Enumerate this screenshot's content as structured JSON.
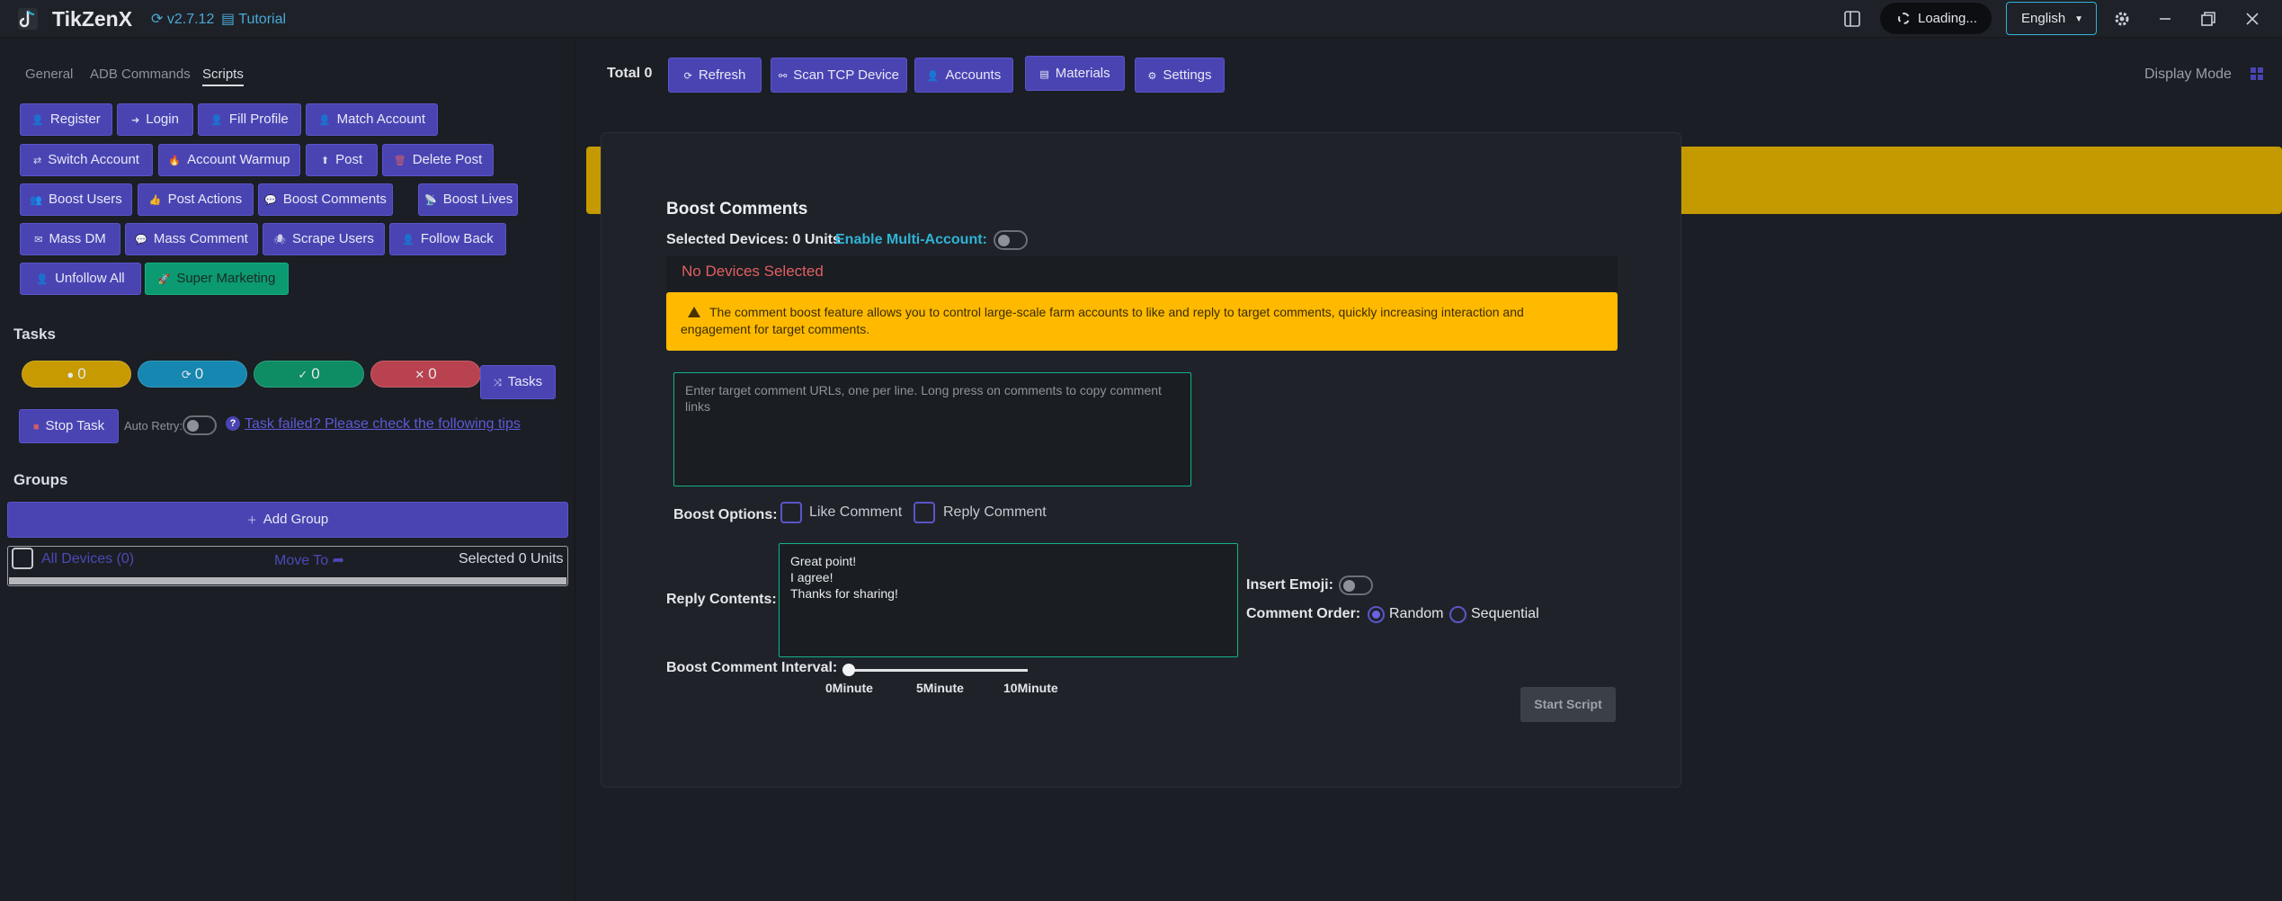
{
  "app": {
    "name": "TikZenX",
    "version": "v2.7.12",
    "tutorial": "Tutorial",
    "loading": "Loading...",
    "language": "English"
  },
  "tabs": [
    "General",
    "ADB Commands",
    "Scripts"
  ],
  "scripts": {
    "register": "Register",
    "login": "Login",
    "fill_profile": "Fill Profile",
    "match_account": "Match Account",
    "switch_account": "Switch Account",
    "account_warmup": "Account Warmup",
    "post": "Post",
    "delete_post": "Delete Post",
    "boost_users": "Boost Users",
    "post_actions": "Post Actions",
    "boost_comments": "Boost Comments",
    "boost_lives": "Boost Lives",
    "mass_dm": "Mass DM",
    "mass_comment": "Mass Comment",
    "scrape_users": "Scrape Users",
    "follow_back": "Follow Back",
    "unfollow_all": "Unfollow All",
    "super_marketing": "Super Marketing"
  },
  "tasks": {
    "title": "Tasks",
    "pending": "0",
    "running": "0",
    "success": "0",
    "failed": "0",
    "tasks_button": "Tasks",
    "stop_task": "Stop Task",
    "auto_retry": "Auto Retry:",
    "help_link": "Task failed? Please check the following tips"
  },
  "groups": {
    "title": "Groups",
    "add_group": "Add Group",
    "all_devices": "All Devices (0)",
    "move_to": "Move To",
    "selected": "Selected 0 Units"
  },
  "header": {
    "total": "Total 0",
    "refresh": "Refresh",
    "scan_tcp": "Scan TCP Device",
    "accounts": "Accounts",
    "materials": "Materials",
    "settings": "Settings",
    "display_mode": "Display Mode"
  },
  "modal": {
    "title": "Boost Comments",
    "selected_devices": "Selected Devices: 0 Units",
    "enable_multi": "Enable Multi-Account:",
    "no_devices": "No Devices Selected",
    "alert_line1": "The comment boost feature allows you to control large-scale farm accounts to like and reply to target comments, quickly increasing interaction and",
    "alert_line2": "engagement for target comments.",
    "urls_placeholder": "Enter target comment URLs, one per line. Long press on comments to copy comment links",
    "boost_options": "Boost Options:",
    "like_comment": "Like Comment",
    "reply_comment": "Reply Comment",
    "reply_contents": "Reply Contents:",
    "reply_text": "Great point!\nI agree!\nThanks for sharing!",
    "insert_emoji": "Insert Emoji:",
    "comment_order": "Comment Order:",
    "random": "Random",
    "sequential": "Sequential",
    "interval_label": "Boost Comment Interval:",
    "interval_value": 0,
    "ticks": [
      "0Minute",
      "5Minute",
      "10Minute"
    ],
    "start_script": "Start Script"
  },
  "colors": {
    "accent": "#4a44b3",
    "teal": "#14b18d",
    "warning": "#ffba00",
    "danger": "#e15f62",
    "cyan": "#2fb3d6"
  },
  "icons": {
    "layout": "sidebar-layout-icon",
    "theme": "gear-icon",
    "minimize": "minimize-icon",
    "restore": "restore-icon",
    "close": "close-icon"
  }
}
